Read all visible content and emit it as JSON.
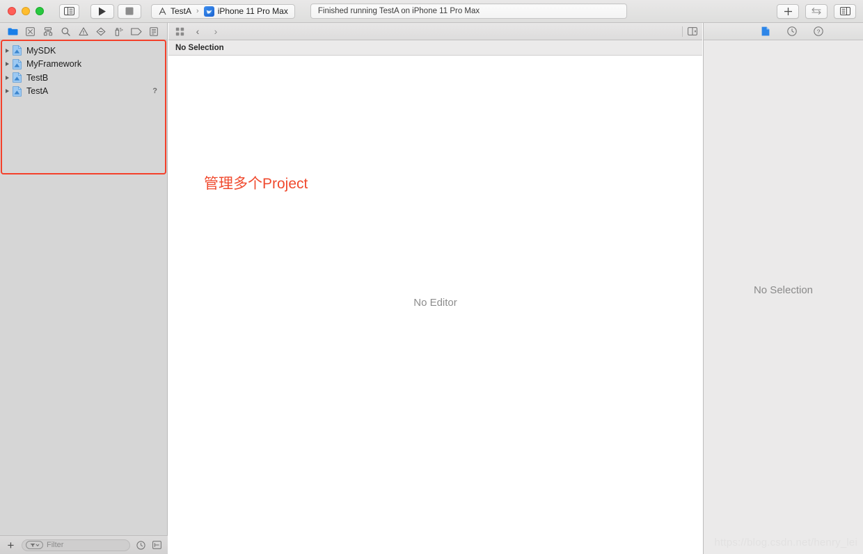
{
  "window": {
    "traffic_lights": [
      "close",
      "minimize",
      "zoom"
    ],
    "sidebar_toggle_label": "sidebar-toggle",
    "run_label": "Run",
    "stop_label": "Stop",
    "scheme": {
      "scheme_name": "TestA",
      "separator": "›",
      "destination": "iPhone 11 Pro Max",
      "scheme_icon": "xcode-scheme-icon",
      "device_icon": "iphone-simulator-icon"
    },
    "status": {
      "text": "Finished running TestA on iPhone 11 Pro Max"
    },
    "right_buttons": [
      {
        "name": "add-editor-button",
        "glyph": "+"
      },
      {
        "name": "code-review-button",
        "glyph": "⇄"
      },
      {
        "name": "inspector-toggle-button",
        "glyph": "panel"
      }
    ]
  },
  "navigator": {
    "tabs": [
      {
        "name": "project-navigator-tab",
        "icon": "folder-icon",
        "active": true
      },
      {
        "name": "source-control-navigator-tab",
        "icon": "source-control-icon",
        "active": false
      },
      {
        "name": "symbol-navigator-tab",
        "icon": "hierarchy-icon",
        "active": false
      },
      {
        "name": "find-navigator-tab",
        "icon": "search-icon",
        "active": false
      },
      {
        "name": "issue-navigator-tab",
        "icon": "warning-triangle-icon",
        "active": false
      },
      {
        "name": "test-navigator-tab",
        "icon": "diamond-icon",
        "active": false
      },
      {
        "name": "debug-navigator-tab",
        "icon": "debug-spray-icon",
        "active": false
      },
      {
        "name": "breakpoint-navigator-tab",
        "icon": "tag-icon",
        "active": false
      },
      {
        "name": "report-navigator-tab",
        "icon": "report-icon",
        "active": false
      }
    ],
    "projects": [
      {
        "label": "MySDK",
        "badge": ""
      },
      {
        "label": "MyFramework",
        "badge": ""
      },
      {
        "label": "TestB",
        "badge": ""
      },
      {
        "label": "TestA",
        "badge": "?"
      }
    ],
    "highlight_color": "#f4402a",
    "bottom_bar": {
      "add_label": "+",
      "filter_placeholder": "Filter",
      "filter_value": "",
      "recent_button": "clock-icon",
      "source-control_button": "filter-box-icon"
    }
  },
  "editor": {
    "jumpbar": {
      "related_items_icon": "grid-icon",
      "back_glyph": "‹",
      "forward_glyph": "›",
      "add_assistant_icon": "assistant-editor-icon"
    },
    "breadcrumb": "No Selection",
    "placeholder": "No Editor",
    "annotation": "管理多个Project",
    "annotation_color": "#f04a2e"
  },
  "inspector": {
    "tabs": [
      {
        "name": "file-inspector-tab",
        "icon": "document-icon",
        "active": true
      },
      {
        "name": "history-inspector-tab",
        "icon": "clock-icon",
        "active": false
      },
      {
        "name": "quick-help-inspector-tab",
        "icon": "question-circle-icon",
        "active": false
      }
    ],
    "placeholder": "No Selection"
  },
  "watermark": {
    "text": "https://blog.csdn.net/henry_lei"
  }
}
